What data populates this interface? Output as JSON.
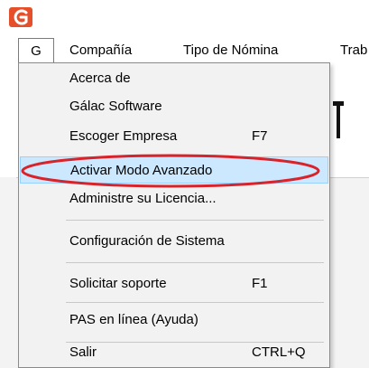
{
  "app": {
    "logo_icon": "galac-logo-icon",
    "logo_color": "#e5502a"
  },
  "menubar": {
    "items": [
      {
        "label": "G"
      },
      {
        "label": "Compañía"
      },
      {
        "label": "Tipo de Nómina"
      },
      {
        "label": "Trab"
      }
    ]
  },
  "dropdown": {
    "items": [
      {
        "label": "Acerca de",
        "shortcut": ""
      },
      {
        "label": "Gálac Software",
        "shortcut": ""
      },
      {
        "label": "Escoger Empresa",
        "shortcut": "F7"
      },
      {
        "label": "Activar Modo Avanzado",
        "shortcut": ""
      },
      {
        "label": "Administre su Licencia...",
        "shortcut": ""
      },
      {
        "label": "Configuración de Sistema",
        "shortcut": ""
      },
      {
        "label": "Solicitar soporte",
        "shortcut": "F1"
      },
      {
        "label": "PAS en línea (Ayuda)",
        "shortcut": ""
      },
      {
        "label": "Salir",
        "shortcut": "CTRL+Q"
      }
    ],
    "highlighted_index": 3,
    "highlight_color": "#cce8ff",
    "annotation_color": "#d8232a"
  }
}
